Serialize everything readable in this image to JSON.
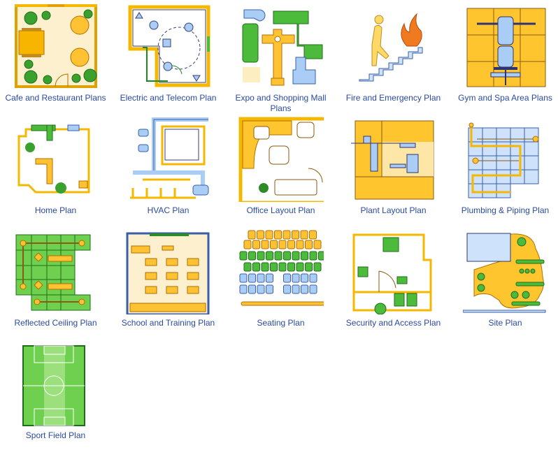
{
  "gallery": {
    "items": [
      {
        "label": "Cafe and Restaurant Plans",
        "icon": "cafe-floorplan-icon"
      },
      {
        "label": "Electric and Telecom Plan",
        "icon": "electric-plan-icon"
      },
      {
        "label": "Expo and Shopping Mall Plans",
        "icon": "expo-mall-icon"
      },
      {
        "label": "Fire and Emergency Plan",
        "icon": "fire-exit-icon"
      },
      {
        "label": "Gym and Spa Area Plans",
        "icon": "gym-bench-icon"
      },
      {
        "label": "Home Plan",
        "icon": "home-plan-icon"
      },
      {
        "label": "HVAC Plan",
        "icon": "hvac-ducts-icon"
      },
      {
        "label": "Office Layout Plan",
        "icon": "office-layout-icon"
      },
      {
        "label": "Plant Layout Plan",
        "icon": "plant-layout-icon"
      },
      {
        "label": "Plumbing & Piping Plan",
        "icon": "plumbing-pipes-icon"
      },
      {
        "label": "Reflected Ceiling Plan",
        "icon": "ceiling-plan-icon"
      },
      {
        "label": "School and Training Plan",
        "icon": "classroom-icon"
      },
      {
        "label": "Seating Plan",
        "icon": "seating-rows-icon"
      },
      {
        "label": "Security and Access Plan",
        "icon": "security-plan-icon"
      },
      {
        "label": "Site Plan",
        "icon": "site-plan-icon"
      },
      {
        "label": "Sport Field Plan",
        "icon": "soccer-field-icon"
      }
    ]
  },
  "colors": {
    "label_text": "#2a4aa3",
    "wall_gold": "#f5b800",
    "plant_green": "#4caf32",
    "fixture_blue": "#a9cdf5"
  }
}
